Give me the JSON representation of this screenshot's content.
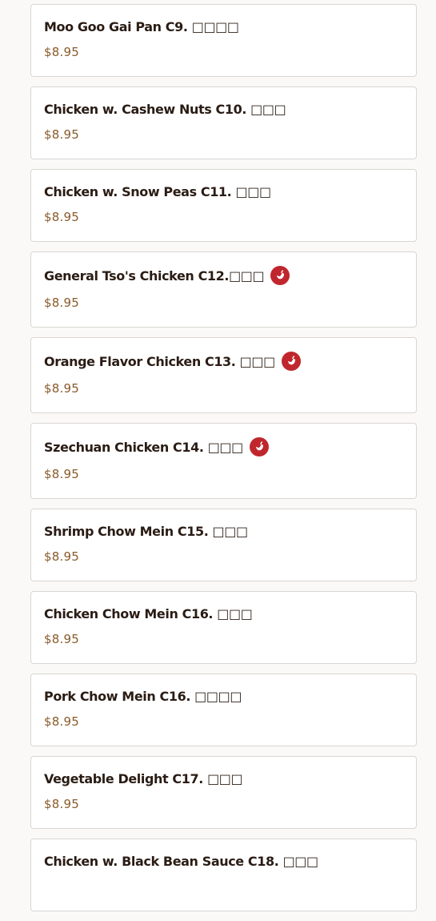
{
  "menu": {
    "items": [
      {
        "name": "",
        "price": "",
        "spicy": false
      },
      {
        "name": "Moo Goo Gai Pan C9. □□□□",
        "price": "$8.95",
        "spicy": false
      },
      {
        "name": "Chicken w. Cashew Nuts C10. □□□",
        "price": "$8.95",
        "spicy": false
      },
      {
        "name": "Chicken w. Snow Peas C11. □□□",
        "price": "$8.95",
        "spicy": false
      },
      {
        "name": "General Tso's Chicken C12.□□□",
        "price": "$8.95",
        "spicy": true
      },
      {
        "name": "Orange Flavor Chicken C13. □□□",
        "price": "$8.95",
        "spicy": true
      },
      {
        "name": "Szechuan Chicken C14. □□□",
        "price": "$8.95",
        "spicy": true
      },
      {
        "name": "Shrimp Chow Mein C15. □□□",
        "price": "$8.95",
        "spicy": false
      },
      {
        "name": "Chicken Chow Mein C16. □□□",
        "price": "$8.95",
        "spicy": false
      },
      {
        "name": "Pork Chow Mein C16. □□□□",
        "price": "$8.95",
        "spicy": false
      },
      {
        "name": "Vegetable Delight C17. □□□",
        "price": "$8.95",
        "spicy": false
      },
      {
        "name": "Chicken w. Black Bean Sauce C18. □□□",
        "price": "",
        "spicy": false
      }
    ]
  },
  "icons": {
    "spicy": "chili-pepper-icon"
  },
  "colors": {
    "background": "#faf9f8",
    "card_border": "#d9d6d2",
    "item_name": "#2a1c14",
    "price": "#8a5a2a",
    "spicy_badge": "#c0262d"
  }
}
